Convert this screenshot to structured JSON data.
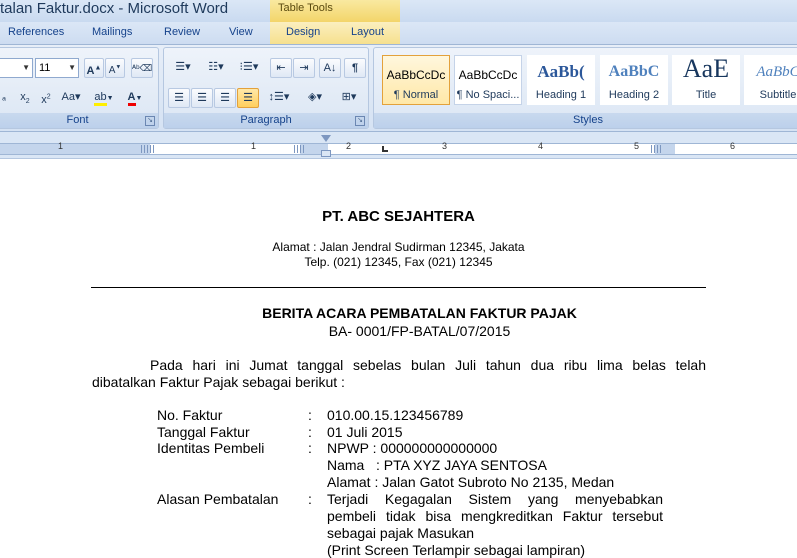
{
  "window": {
    "title": "talan Faktur.docx - Microsoft Word",
    "contextual_tab_group": "Table Tools"
  },
  "tabs": [
    "References",
    "Mailings",
    "Review",
    "View",
    "Design",
    "Layout"
  ],
  "ribbon": {
    "font": {
      "size": "11",
      "group_label": "Font"
    },
    "paragraph": {
      "group_label": "Paragraph"
    },
    "styles": {
      "group_label": "Styles",
      "items": [
        {
          "sample": "AaBbCcDc",
          "name": "¶ Normal"
        },
        {
          "sample": "AaBbCcDc",
          "name": "¶ No Spaci..."
        },
        {
          "sample": "AaBb(",
          "name": "Heading 1"
        },
        {
          "sample": "AaBbC",
          "name": "Heading 2"
        },
        {
          "sample": "AaE",
          "name": "Title"
        },
        {
          "sample": "AaBbC",
          "name": "Subtitle"
        }
      ]
    }
  },
  "ruler": {
    "numbers": [
      "1",
      "1",
      "2",
      "3",
      "4",
      "5",
      "6"
    ]
  },
  "document": {
    "company": "PT. ABC SEJAHTERA",
    "address": "Alamat : Jalan Jendral Sudirman 12345, Jakata",
    "phone": "Telp. (021) 12345, Fax (021) 12345",
    "heading": "BERITA ACARA PEMBATALAN FAKTUR PAJAK",
    "number": "BA- 0001/FP-BATAL/07/2015",
    "intro_line1": "Pada hari ini Jumat tanggal sebelas bulan Juli tahun dua ribu lima belas telah",
    "intro_line2": "dibatalkan Faktur Pajak sebagai berikut :",
    "fields": [
      {
        "label": "No. Faktur",
        "colon": ":",
        "value": "010.00.15.123456789"
      },
      {
        "label": "Tanggal Faktur",
        "colon": ":",
        "value": "01 Juli 2015"
      },
      {
        "label": "Identitas Pembeli",
        "colon": ":",
        "value": "NPWP : 000000000000000"
      },
      {
        "label": "",
        "colon": "",
        "value": "Nama   : PTA XYZ JAYA SENTOSA"
      },
      {
        "label": "",
        "colon": "",
        "value": "Alamat : Jalan Gatot Subroto No 2135, Medan"
      },
      {
        "label": "Alasan Pembatalan",
        "colon": ":",
        "value": "Terjadi Kegagalan Sistem yang menyebabkan"
      },
      {
        "label": "",
        "colon": "",
        "value": "pembeli tidak bisa mengkreditkan Faktur tersebut"
      },
      {
        "label": "",
        "colon": "",
        "value": "sebagai pajak Masukan"
      },
      {
        "label": "",
        "colon": "",
        "value": "(Print Screen Terlampir sebagai lampiran)"
      }
    ]
  }
}
